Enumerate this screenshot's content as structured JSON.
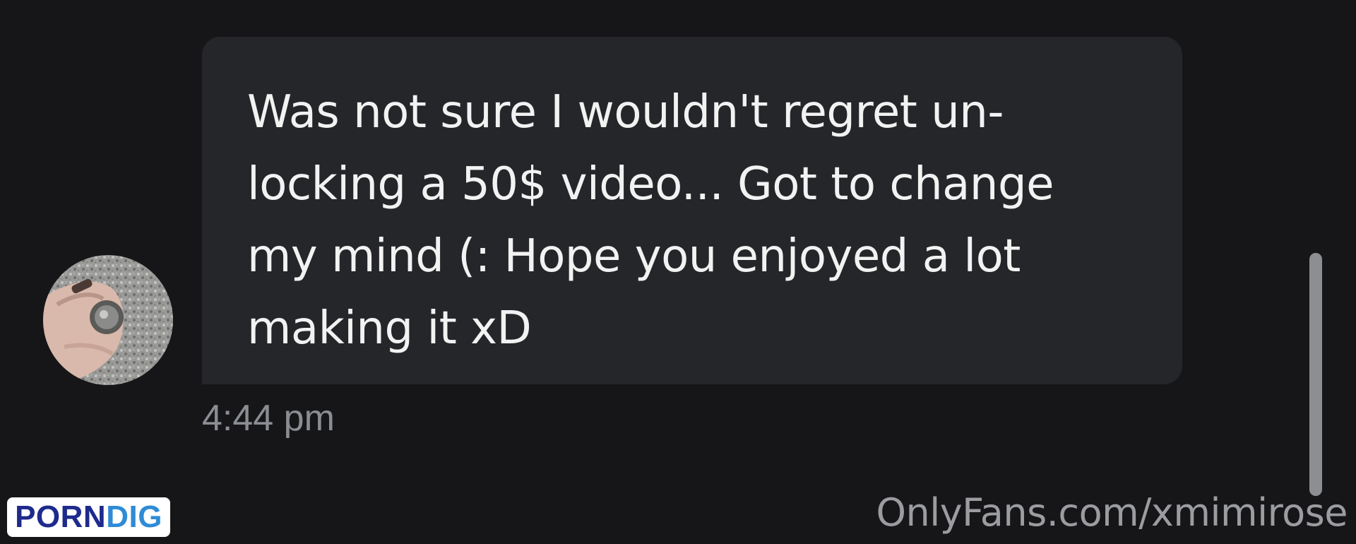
{
  "chat": {
    "message": {
      "lines": [
        "Was not sure I wouldn't regret un-",
        "locking a 50$ video... Got to change",
        "my mind (: Hope you enjoyed a lot",
        "making it xD"
      ],
      "time": "4:44 pm"
    },
    "avatar": {
      "icon": "sender-avatar-photo"
    }
  },
  "watermark": {
    "part1": "PORN",
    "part2": "DIG",
    "url": "OnlyFans.com/xmimirose"
  },
  "colors": {
    "background": "#161618",
    "bubble": "#252629",
    "message_text": "#f2f2f2",
    "timestamp": "#8a8d93",
    "scrollbar": "#8d8e91"
  }
}
